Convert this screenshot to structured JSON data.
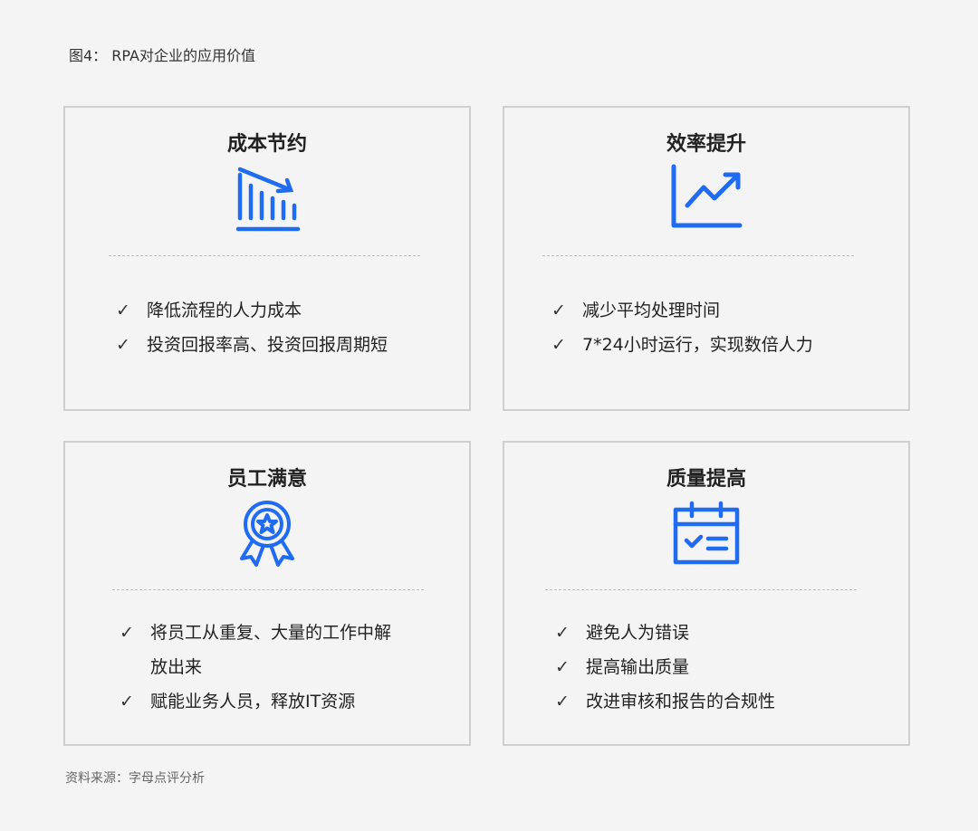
{
  "figure": {
    "title": "图4： RPA对企业的应用价值"
  },
  "colors": {
    "accent": "#1f6bf2",
    "border": "#cfcfcf",
    "background": "#f4f4f4"
  },
  "cards": [
    {
      "title": "成本节约",
      "icon": "cost-down-chart-icon",
      "items": [
        "降低流程的人力成本",
        "投资回报率高、投资回报周期短"
      ]
    },
    {
      "title": "效率提升",
      "icon": "efficiency-line-chart-icon",
      "items": [
        "减少平均处理时间",
        "7*24小时运行，实现数倍人力"
      ]
    },
    {
      "title": "员工满意",
      "icon": "award-star-icon",
      "items": [
        "将员工从重复、大量的工作中解放出来",
        "赋能业务人员，释放IT资源"
      ]
    },
    {
      "title": "质量提高",
      "icon": "calendar-check-icon",
      "items": [
        "避免人为错误",
        "提高输出质量",
        "改进审核和报告的合规性"
      ]
    }
  ],
  "check_symbol": "✓",
  "source": "资料来源：字母点评分析"
}
